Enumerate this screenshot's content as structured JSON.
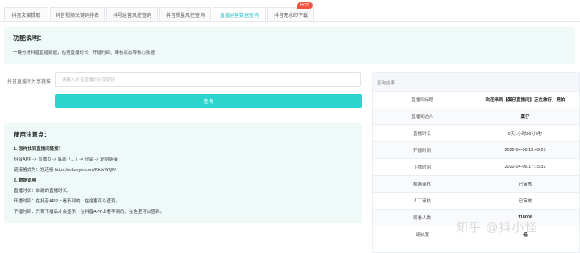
{
  "tabs": [
    {
      "label": "抖音文案提取",
      "active": false
    },
    {
      "label": "抖音视频关键词排名",
      "active": false
    },
    {
      "label": "抖号运营风控查询",
      "active": false
    },
    {
      "label": "抖音质量风控查询",
      "active": false
    },
    {
      "label": "直播运营数据查询",
      "active": true
    },
    {
      "label": "抖音无水印下载",
      "active": false
    }
  ],
  "hot_badge": "HOT",
  "function_card": {
    "title": "功能说明：",
    "description": "一键分析抖音直播数据，包括直播时长、开播时间、审核状态等核心数据"
  },
  "form": {
    "label": "抖音直播间分享链接：",
    "placeholder": "请输入抖音直播间分享链接",
    "button_label": "查询"
  },
  "notes": {
    "title": "使用注意点：",
    "lines": [
      {
        "text": "1. 怎样找到直播间链接？",
        "bold": true
      },
      {
        "text": "抖音APP -> 直播页 -> 底部「...」-> 分享 -> 复制链接",
        "bold": false
      },
      {
        "text": "链接格式为：短连接 https://v.douyin.com/Rk5rWQF/",
        "bold": false
      },
      {
        "text": "2. 数据说明",
        "bold": true
      },
      {
        "text": "直播时长：准确的直播时长。",
        "bold": false
      },
      {
        "text": "开播时间：在抖音APP上看不到的，在这里可以查到。",
        "bold": false
      },
      {
        "text": "下播时间：只有下播后才会显示，在抖音APP上看不到的，在这里可以查到。",
        "bold": false
      }
    ]
  },
  "result": {
    "header": "查询结果",
    "rows": [
      {
        "label": "直播间标题",
        "value": "欢迎来到【蛋仔直播间】正在旅行，竞拍",
        "bold": true
      },
      {
        "label": "直播间达人",
        "value": "蛋仔",
        "bold": true
      },
      {
        "label": "直播时长",
        "value": "0天1小时26分9秒",
        "bold": false
      },
      {
        "label": "开播时间",
        "value": "2022-04-06 15:49:23",
        "bold": false
      },
      {
        "label": "下播时间",
        "value": "2022-04-06 17:15:32",
        "bold": false
      },
      {
        "label": "机器审核",
        "value": "已审核",
        "bold": false
      },
      {
        "label": "人工审核",
        "value": "已审核",
        "bold": false
      },
      {
        "label": "观看人数",
        "value": "118008",
        "bold": true
      },
      {
        "label": "疑似度",
        "value": "低",
        "bold": true
      }
    ]
  },
  "watermark": "知乎 @抖小怪",
  "colors": {
    "accent": "#2bd4cd",
    "active_tab": "#2bbfc8",
    "card_bg": "#eef9f8",
    "hot": "#f5533d"
  }
}
